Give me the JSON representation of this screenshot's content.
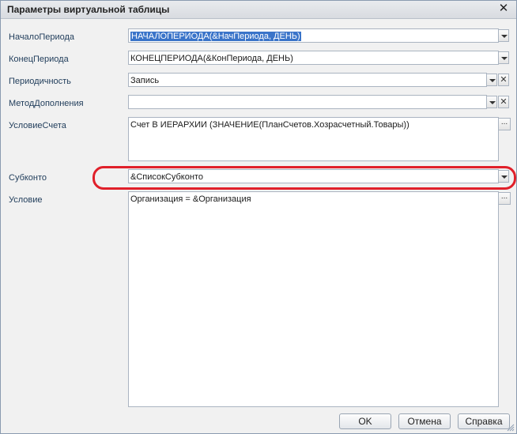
{
  "dialog": {
    "title": "Параметры виртуальной таблицы",
    "close_glyph": "✕"
  },
  "fields": {
    "start": {
      "label": "НачалоПериода",
      "value": "НАЧАЛОПЕРИОДА(&НачПериода, ДЕНЬ)"
    },
    "end": {
      "label": "КонецПериода",
      "value": "КОНЕЦПЕРИОДА(&КонПериода, ДЕНЬ)"
    },
    "periodicity": {
      "label": "Периодичность",
      "value": "Запись"
    },
    "fill_method": {
      "label": "МетодДополнения",
      "value": ""
    },
    "account_condition": {
      "label": "УсловиеСчета",
      "value": "Счет В ИЕРАРХИИ (ЗНАЧЕНИЕ(ПланСчетов.Хозрасчетный.Товары))"
    },
    "subconto": {
      "label": "Субконто",
      "value": "&СписокСубконто"
    },
    "condition": {
      "label": "Условие",
      "value": "Организация = &Организация"
    }
  },
  "glyphs": {
    "clear": "✕",
    "ellipsis": "..."
  },
  "buttons": {
    "ok": "OK",
    "cancel": "Отмена",
    "help": "Справка"
  },
  "colors": {
    "highlight": "#e0202a",
    "selection": "#3a74c9"
  }
}
